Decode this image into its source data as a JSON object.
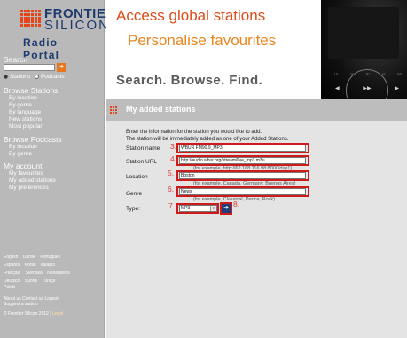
{
  "brand": {
    "name_line1": "FRONTIER",
    "name_line2": "SILICON",
    "portal": "Radio Portal",
    "accent": "#e4451a",
    "navy": "#1d3a6e"
  },
  "sidebar": {
    "search_heading": "Search",
    "search_button": "➜",
    "search_option_stations": "Stations",
    "search_option_podcasts": "Podcasts",
    "browse_stations_heading": "Browse Stations",
    "browse_stations": [
      "By location",
      "By genre",
      "By language",
      "New stations",
      "Most popular"
    ],
    "browse_podcasts_heading": "Browse Podcasts",
    "browse_podcasts": [
      "By location",
      "By genre"
    ],
    "account_heading": "My account",
    "account_links": [
      "My favourites",
      "My added stations",
      "My preferences"
    ],
    "languages": [
      [
        "English",
        "Dansk",
        "Português"
      ],
      [
        "Español",
        "Norsk",
        "Italiano"
      ],
      [
        "Français",
        "Svenska",
        "Nederlands"
      ],
      [
        "Deutsch",
        "Suomi",
        "Türkçe"
      ],
      [
        "Polski"
      ]
    ],
    "footer_about": "About us",
    "footer_contact": "Contact us",
    "footer_logout": "Logout",
    "footer_suggest": "Suggest a station",
    "footer_copyright": "© Frontier Silicon 2012 |",
    "footer_legal": "Legal"
  },
  "banner": {
    "tagline1": "Access global stations",
    "tagline2": "Personalise favourites",
    "tagline3": "Search. Browse. Find.",
    "device_presets": [
      "1D",
      "2T",
      "3D",
      "4S",
      "5/0"
    ],
    "device_controls": [
      "◀",
      "▶▶",
      "▶"
    ]
  },
  "page": {
    "title": "My added stations",
    "intro_line1": "Enter the information for the station you would like to add.",
    "intro_line2": "The station will be immediately added as one of your Added Stations."
  },
  "form": {
    "name": {
      "label": "Station name",
      "step": "3.",
      "value": "WBUR FM90.9_MP3"
    },
    "url": {
      "label": "Station URL",
      "step": "4.",
      "value": "http://audio.wbur.org/stream/live_mp3.m3u",
      "hint": "(for example, http://62.168.116.98:8000/dsp1)"
    },
    "location": {
      "label": "Location",
      "step": "5.",
      "value": "Boston",
      "hint": "(for example, Canada, Germany, Buenos Aires)"
    },
    "genre": {
      "label": "Genre",
      "step": "6.",
      "value": "News",
      "hint": "(for example, Classical, Dance, Rock)"
    },
    "type": {
      "label": "Type:",
      "step": "7.",
      "value": "MP3",
      "arrow": "▼"
    },
    "submit": {
      "label": "➜",
      "step": "8."
    }
  }
}
